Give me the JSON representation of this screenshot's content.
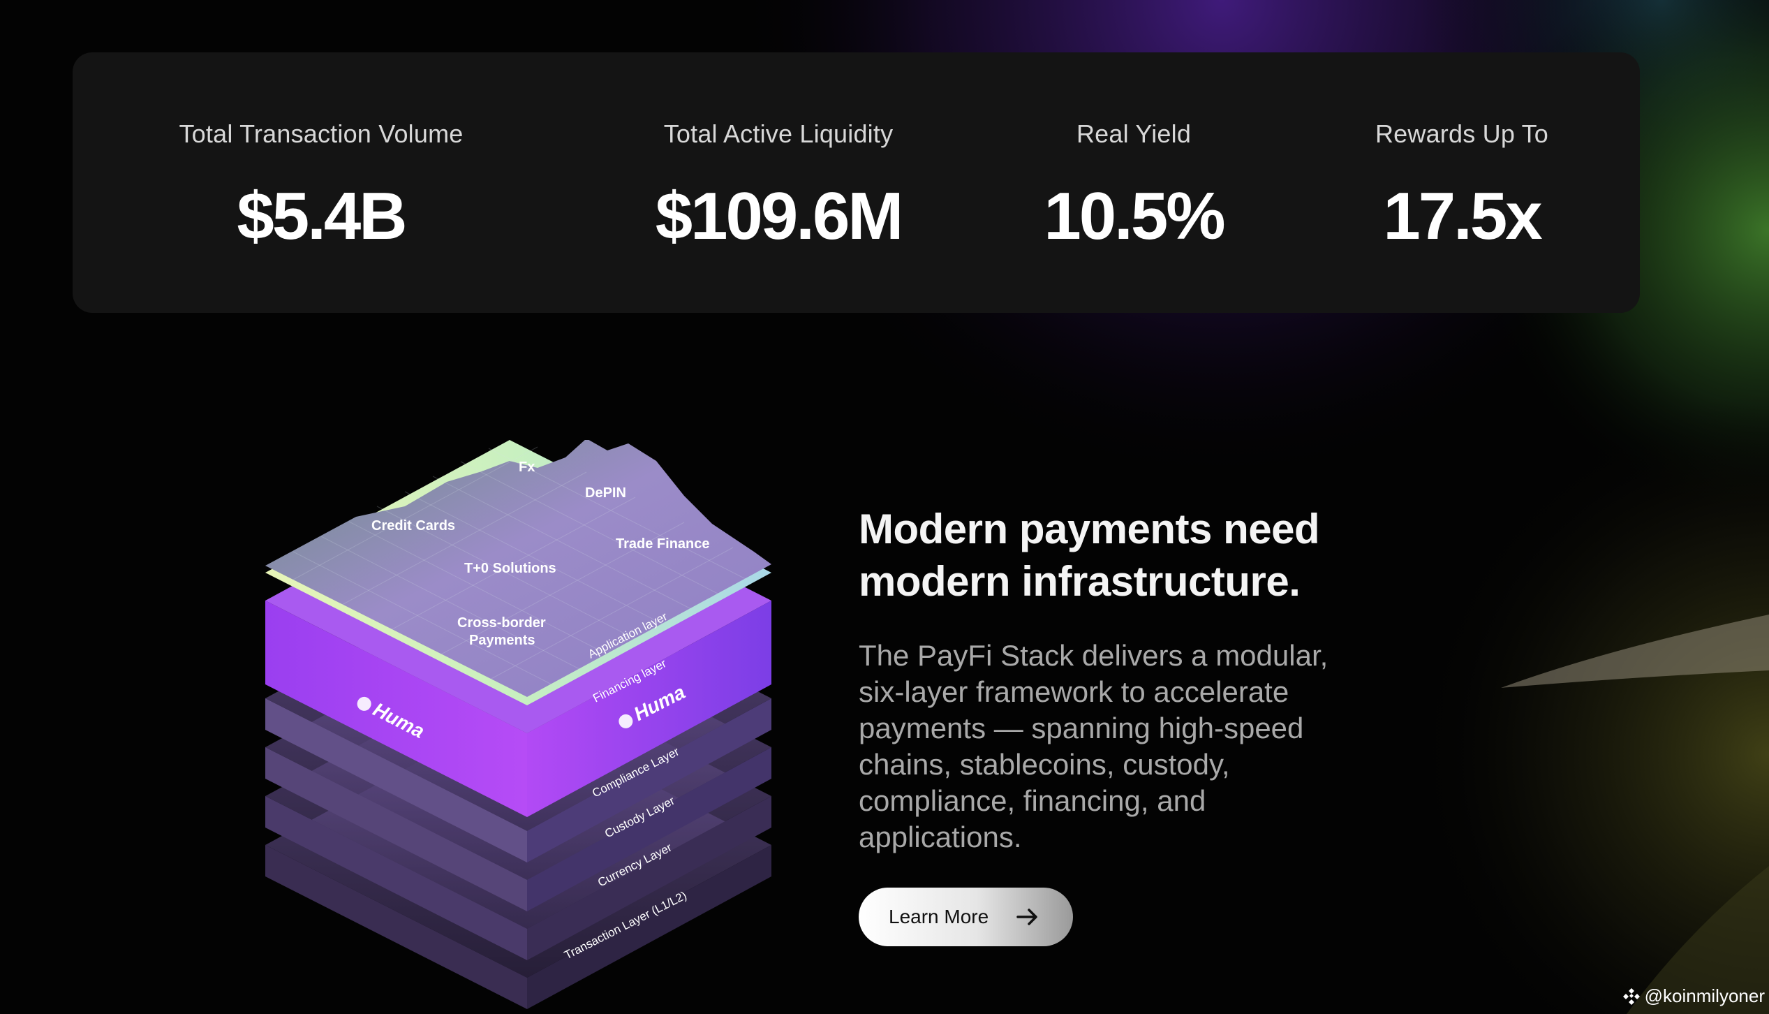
{
  "stats": [
    {
      "label": "Total Transaction Volume",
      "value": "$5.4B"
    },
    {
      "label": "Total Active Liquidity",
      "value": "$109.6M"
    },
    {
      "label": "Real Yield",
      "value": "10.5%"
    },
    {
      "label": "Rewards Up To",
      "value": "17.5x"
    }
  ],
  "hero": {
    "headline": "Modern payments need modern infrastructure.",
    "body": "The PayFi Stack delivers a modular, six-layer framework to accelerate payments — spanning high-speed chains, stablecoins, custody, compliance, financing, and applications.",
    "cta_label": "Learn More"
  },
  "stack": {
    "brand": "Huma",
    "map_labels": {
      "fx": "Fx",
      "depin": "DePIN",
      "credit_cards": "Credit Cards",
      "trade_finance": "Trade Finance",
      "t0_solutions": "T+0 Solutions",
      "cross_border_1": "Cross-border",
      "cross_border_2": "Payments"
    },
    "layers": {
      "application": "Application layer",
      "financing": "Financing layer",
      "compliance": "Compliance Layer",
      "custody": "Custody Layer",
      "currency": "Currency Layer",
      "transaction": "Transaction Layer (L1/L2)"
    }
  },
  "watermark": {
    "handle": "@koinmilyoner"
  },
  "colors": {
    "background": "#030303",
    "card": "#141414",
    "accent_purple": "#a64df5"
  }
}
